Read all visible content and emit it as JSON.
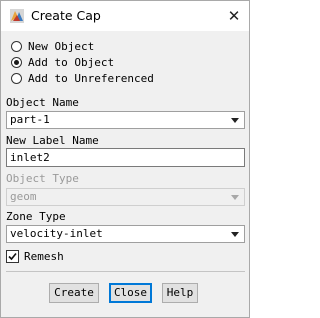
{
  "window": {
    "title": "Create Cap",
    "icon": "fluent-app-icon",
    "close_glyph": "✕"
  },
  "options": [
    {
      "label": "New Object",
      "selected": false
    },
    {
      "label": "Add to Object",
      "selected": true
    },
    {
      "label": "Add to Unreferenced",
      "selected": false
    }
  ],
  "object_name": {
    "label": "Object Name",
    "value": "part-1"
  },
  "new_label_name": {
    "label": "New Label Name",
    "value": "inlet2"
  },
  "object_type": {
    "label": "Object Type",
    "value": "geom",
    "disabled": true
  },
  "zone_type": {
    "label": "Zone Type",
    "value": "velocity-inlet"
  },
  "remesh": {
    "label": "Remesh",
    "checked": true
  },
  "buttons": {
    "create": "Create",
    "close": "Close",
    "help": "Help"
  }
}
